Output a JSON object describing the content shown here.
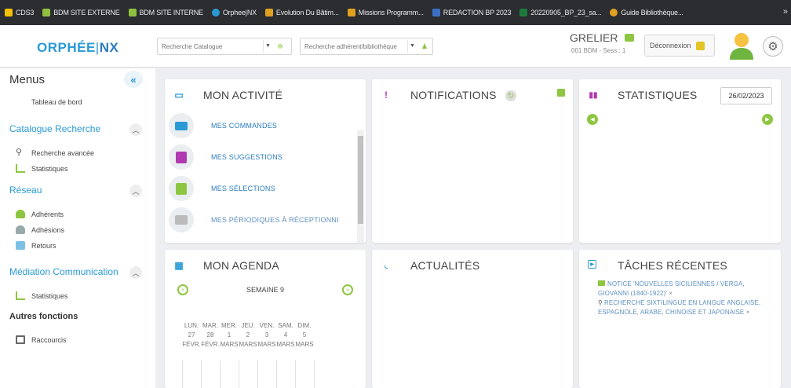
{
  "bookmarks": [
    {
      "label": "CDS3",
      "color": "#f5c000"
    },
    {
      "label": "BDM SITE EXTERNE",
      "color": "#8fbf3f"
    },
    {
      "label": "BDM SITE INTERNE",
      "color": "#8fbf3f"
    },
    {
      "label": "Orphee|NX",
      "color": "#2a9ad6"
    },
    {
      "label": "Evolution Du Bâtim...",
      "color": "#e0a020"
    },
    {
      "label": "Missions Programm...",
      "color": "#e0a020"
    },
    {
      "label": "REDACTION BP 2023",
      "color": "#3b6fc4"
    },
    {
      "label": "20220905_BP_23_sa...",
      "color": "#1d7a3e"
    },
    {
      "label": "Guide Bibliothèque...",
      "color": "#e0a020"
    }
  ],
  "bookmarks_more": "»",
  "logo": {
    "part1": "ORPHÉE",
    "sep": "|",
    "part2": "NX"
  },
  "search_catalogue": {
    "placeholder": "Recherche Catalogue"
  },
  "search_adherents": {
    "placeholder": "Recherche adhérent/bibliothèque"
  },
  "user": {
    "name": "GRELIER",
    "sub": "001 BDM - Sess : 1"
  },
  "logout_label": "Déconnexion",
  "sidebar": {
    "title": "Menus",
    "dashboard": "Tableau de bord",
    "sections": [
      {
        "title": "Catalogue Recherche",
        "items": [
          "Recherche avancée",
          "Statistiques"
        ]
      },
      {
        "title": "Réseau",
        "items": [
          "Adhérents",
          "Adhésions",
          "Retours"
        ]
      },
      {
        "title": "Médiation Communication",
        "items": [
          "Statistiques"
        ]
      },
      {
        "title": "Autres fonctions",
        "items": [
          "Raccourcis"
        ]
      }
    ]
  },
  "activity": {
    "title": "MON ACTIVITÉ",
    "items": [
      "MES COMMANDES",
      "MES SUGGESTIONS",
      "MES SÉLECTIONS",
      "MES PÉRIODIQUES À RÉCEPTIONNI"
    ]
  },
  "notifications": {
    "title": "NOTIFICATIONS"
  },
  "statistics": {
    "title": "STATISTIQUES",
    "date": "26/02/2023"
  },
  "agenda": {
    "title": "MON AGENDA",
    "week": "SEMAINE 9",
    "days": [
      {
        "name": "LUN.",
        "num": "27",
        "month": "FÉVR."
      },
      {
        "name": "MAR.",
        "num": "28",
        "month": "FÉVR."
      },
      {
        "name": "MER.",
        "num": "1",
        "month": "MARS"
      },
      {
        "name": "JEU.",
        "num": "2",
        "month": "MARS"
      },
      {
        "name": "VEN.",
        "num": "3",
        "month": "MARS"
      },
      {
        "name": "SAM.",
        "num": "4",
        "month": "MARS"
      },
      {
        "name": "DIM.",
        "num": "5",
        "month": "MARS"
      }
    ]
  },
  "news": {
    "title": "ACTUALITÉS"
  },
  "tasks": {
    "title": "TÂCHES RÉCENTES",
    "items": [
      "NOTICE 'NOUVELLES SICILIENNES / VERGA, GIOVANNI (1840-1922)'",
      "RECHERCHE SIXTILINGUE EN LANGUE ANGLAISE, ESPAGNOLE, ARABE, CHINOISE ET JAPONAISE"
    ],
    "close": "×"
  }
}
